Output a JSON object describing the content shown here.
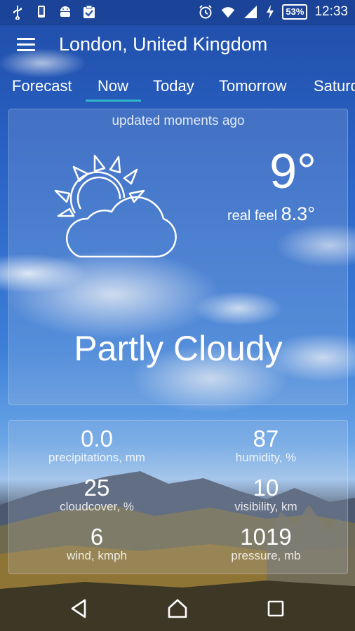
{
  "status_bar": {
    "left_icons": [
      "usb-icon",
      "phone-icon",
      "android-icon",
      "clipboard-check-icon"
    ],
    "right_icons": [
      "alarm-icon",
      "wifi-icon",
      "signal-icon",
      "charging-icon"
    ],
    "battery": "53%",
    "time": "12:33"
  },
  "appbar": {
    "title": "London, United Kingdom"
  },
  "tabs": [
    "Forecast",
    "Now",
    "Today",
    "Tomorrow",
    "Saturday"
  ],
  "active_tab": "Now",
  "accent_color": "#2fb6c8",
  "now": {
    "updated": "updated moments ago",
    "temperature": "9°",
    "real_feel_label": "real feel",
    "real_feel_value": "8.3°",
    "condition": "Partly Cloudy",
    "icon": "partly-cloudy-icon"
  },
  "stats": [
    {
      "value": "0.0",
      "label": "precipitations, mm"
    },
    {
      "value": "87",
      "label": "humidity, %"
    },
    {
      "value": "25",
      "label": "cloudcover, %"
    },
    {
      "value": "10",
      "label": "visibility, km"
    },
    {
      "value": "6",
      "label": "wind, kmph"
    },
    {
      "value": "1019",
      "label": "pressure, mb"
    }
  ],
  "nav": [
    "back-icon",
    "home-icon",
    "recents-icon"
  ]
}
